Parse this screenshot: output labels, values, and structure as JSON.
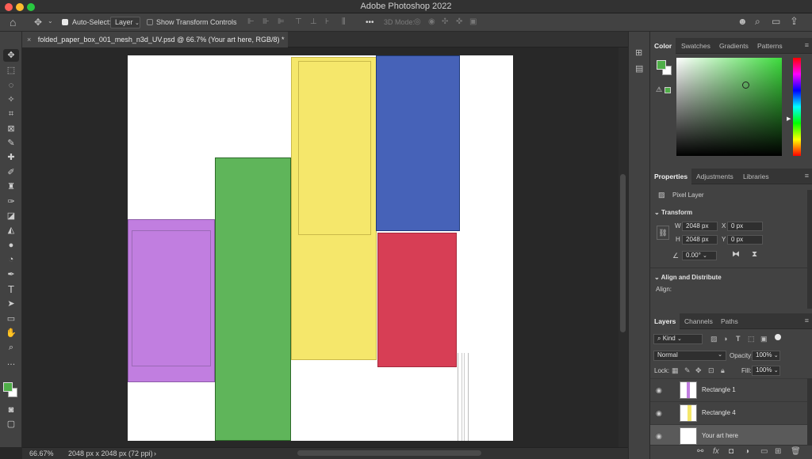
{
  "app": {
    "title": "Adobe Photoshop 2022"
  },
  "options_bar": {
    "auto_select_label": "Auto-Select:",
    "auto_select_checked": true,
    "auto_select_target": "Layer",
    "show_transform_label": "Show Transform Controls",
    "show_transform_checked": false,
    "three_d_mode_label": "3D Mode:",
    "more_label": "•••"
  },
  "document": {
    "tab_label": "folded_paper_box_001_mesh_n3d_UV.psd @ 66.7% (Your art here, RGB/8) *",
    "close_glyph": "×"
  },
  "status": {
    "zoom": "66.67%",
    "doc_info": "2048 px x 2048 px (72 ppi)",
    "arrow": "›"
  },
  "color_panel": {
    "tabs": [
      "Color",
      "Swatches",
      "Gradients",
      "Patterns"
    ],
    "active_tab": "Color",
    "foreground": "#4fae48",
    "background": "#ffffff",
    "hue": "#3ddb3d"
  },
  "properties_panel": {
    "tabs": [
      "Properties",
      "Adjustments",
      "Libraries"
    ],
    "active_tab": "Properties",
    "layer_type": "Pixel Layer",
    "transform_header": "Transform",
    "w_label": "W",
    "w_value": "2048 px",
    "h_label": "H",
    "h_value": "2048 px",
    "x_label": "X",
    "x_value": "0 px",
    "y_label": "Y",
    "y_value": "0 px",
    "angle_value": "0.00°",
    "align_header": "Align and Distribute",
    "align_label": "Align:"
  },
  "layers_panel": {
    "tabs": [
      "Layers",
      "Channels",
      "Paths"
    ],
    "active_tab": "Layers",
    "kind_label": "Kind",
    "blend_mode": "Normal",
    "opacity_label": "Opacity:",
    "opacity_value": "100%",
    "lock_label": "Lock:",
    "fill_label": "Fill:",
    "fill_value": "100%",
    "layers": [
      {
        "name": "Rectangle 1",
        "thumb": "#c17ee0"
      },
      {
        "name": "Rectangle 4",
        "thumb": "#f5e76b"
      },
      {
        "name": "Your art here",
        "thumb": "#ffffff"
      }
    ],
    "footer_icons": [
      "link-icon",
      "fx-icon",
      "mask-icon",
      "adjustment-icon",
      "group-icon",
      "new-layer-icon",
      "trash-icon"
    ]
  },
  "artwork": {
    "pieces": [
      {
        "name": "purple-panel",
        "color": "#c17ee0"
      },
      {
        "name": "green-panel",
        "color": "#5fb55a"
      },
      {
        "name": "yellow-panel",
        "color": "#f5e76b"
      },
      {
        "name": "blue-panel",
        "color": "#4662b8"
      },
      {
        "name": "red-panel",
        "color": "#d73e55"
      }
    ]
  }
}
